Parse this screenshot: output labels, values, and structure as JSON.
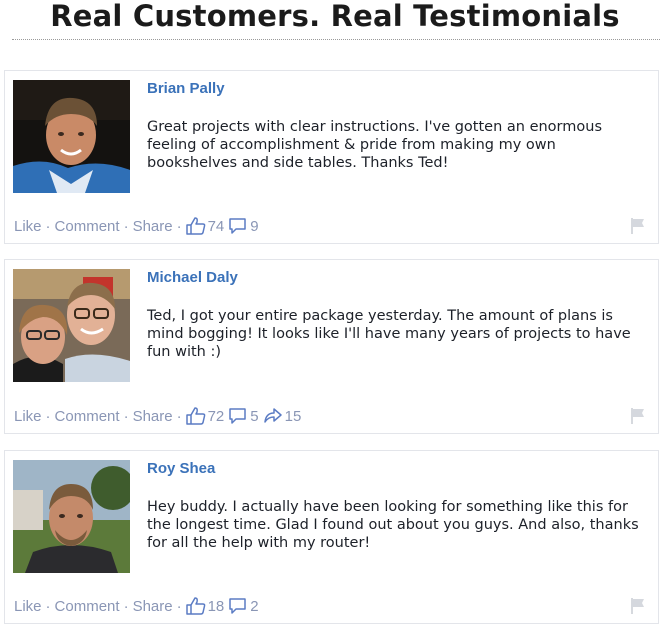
{
  "header": {
    "title": "Real Customers. Real Testimonials"
  },
  "actions": {
    "like": "Like",
    "comment": "Comment",
    "share": "Share",
    "separator": "·"
  },
  "posts": [
    {
      "author": "Brian Pally",
      "text": "Great projects with clear instructions. I've gotten an enormous feeling of accomplishment & pride from making my own bookshelves and side tables. Thanks Ted!",
      "likes": "74",
      "comments": "9"
    },
    {
      "author": "Michael Daly",
      "text": "Ted, I got your entire package yesterday. The amount of plans is mind bogging! It looks like I'll have many years of projects to have fun with :)",
      "likes": "72",
      "comments": "5",
      "shares": "15"
    },
    {
      "author": "Roy Shea",
      "text": "Hey buddy. I actually have been looking for something like this for the longest time. Glad I found out about you guys. And also, thanks for all the help with my router!",
      "likes": "18",
      "comments": "2"
    }
  ],
  "colors": {
    "author_link": "#3b72b9",
    "action_text": "#8a96b5",
    "body_text": "#1d2129",
    "card_border": "#e3e5ea"
  },
  "icons": {
    "like": "thumbs-up-icon",
    "comment": "speech-bubble-icon",
    "share": "share-arrow-icon",
    "report": "flag-icon"
  }
}
